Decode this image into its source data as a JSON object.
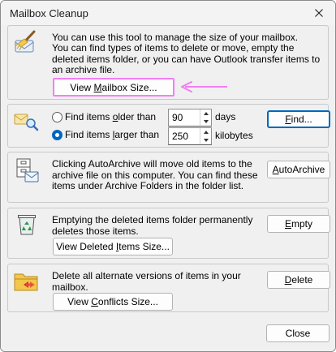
{
  "window": {
    "title": "Mailbox Cleanup"
  },
  "colors": {
    "accent": "#0067c0",
    "annotation": "#f27ff2"
  },
  "icons": {
    "mailbox": "mailbox-broom-icon",
    "find": "envelope-magnifier-icon",
    "archive": "archive-envelope-icon",
    "recycle": "recycle-bin-icon",
    "conflicts": "folder-conflict-icon",
    "annotation": "pointer-arrow-icon"
  },
  "intro": {
    "line1": "You can use this tool to manage the size of your mailbox.",
    "line2": "You can find types of items to delete or move, empty the deleted items folder, or you can have Outlook transfer items to an archive file.",
    "view_size": {
      "pre": "View ",
      "key": "M",
      "post": "ailbox Size..."
    }
  },
  "find": {
    "older": {
      "pre": "Find items ",
      "key": "o",
      "post": "lder than",
      "checked": false,
      "value": "90",
      "unit": "days"
    },
    "larger": {
      "pre": "Find items ",
      "key": "l",
      "post": "arger than",
      "checked": true,
      "value": "250",
      "unit": "kilobytes"
    },
    "button": {
      "pre": "",
      "key": "F",
      "post": "ind..."
    }
  },
  "archive": {
    "text": "Clicking AutoArchive will move old items to the archive file on this computer. You can find these items under Archive Folders in the folder list.",
    "button": {
      "pre": "",
      "key": "A",
      "post": "utoArchive"
    }
  },
  "empty": {
    "text": "Emptying the deleted items folder permanently deletes those items.",
    "view": {
      "pre": "View Deleted ",
      "key": "I",
      "post": "tems Size..."
    },
    "button": {
      "pre": "",
      "key": "E",
      "post": "mpty"
    }
  },
  "conflicts": {
    "text": "Delete all alternate versions of items in your mailbox.",
    "view": {
      "pre": "View ",
      "key": "C",
      "post": "onflicts Size..."
    },
    "button": {
      "pre": "",
      "key": "D",
      "post": "elete"
    }
  },
  "footer": {
    "close": "Close"
  }
}
